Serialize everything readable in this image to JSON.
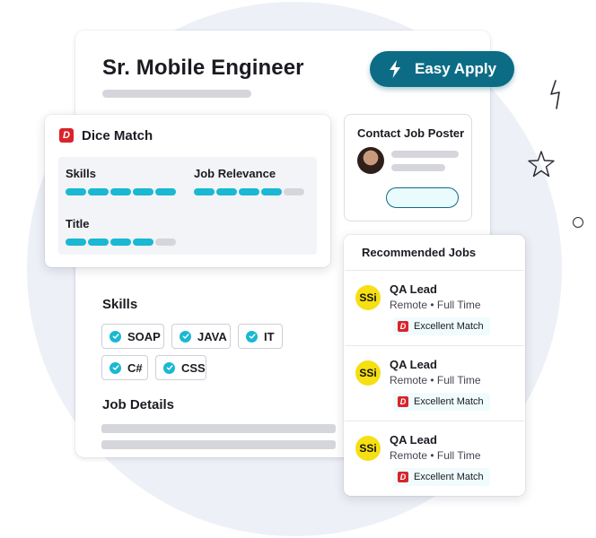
{
  "job": {
    "title": "Sr. Mobile Engineer",
    "apply_label": "Easy Apply"
  },
  "dice_match": {
    "logo_letter": "D",
    "title": "Dice Match",
    "metrics": [
      {
        "label": "Skills",
        "filled": 5,
        "total": 5
      },
      {
        "label": "Job Relevance",
        "filled": 4,
        "total": 5
      },
      {
        "label": "Title",
        "filled": 4,
        "total": 5
      }
    ]
  },
  "contact": {
    "title": "Contact Job Poster"
  },
  "recommended": {
    "title": "Recommended Jobs",
    "items": [
      {
        "logo": "SSi",
        "title": "QA Lead",
        "meta": "Remote • Full Time",
        "badge": "Excellent Match"
      },
      {
        "logo": "SSi",
        "title": "QA Lead",
        "meta": "Remote • Full Time",
        "badge": "Excellent Match"
      },
      {
        "logo": "SSi",
        "title": "QA Lead",
        "meta": "Remote • Full Time",
        "badge": "Excellent Match"
      }
    ]
  },
  "skills": {
    "heading": "Skills",
    "chips": [
      "SOAP",
      "JAVA",
      "IT",
      "C#",
      "CSS"
    ]
  },
  "details": {
    "heading": "Job Details"
  },
  "colors": {
    "accent": "#0d6c85",
    "bar": "#1ab8d2",
    "dice_red": "#d9242b",
    "ssi_yellow": "#f6df12",
    "background_circle": "#eef0f7"
  },
  "icons": [
    "lightning-bolt-icon",
    "check-icon",
    "dice-logo-icon",
    "star-icon"
  ]
}
